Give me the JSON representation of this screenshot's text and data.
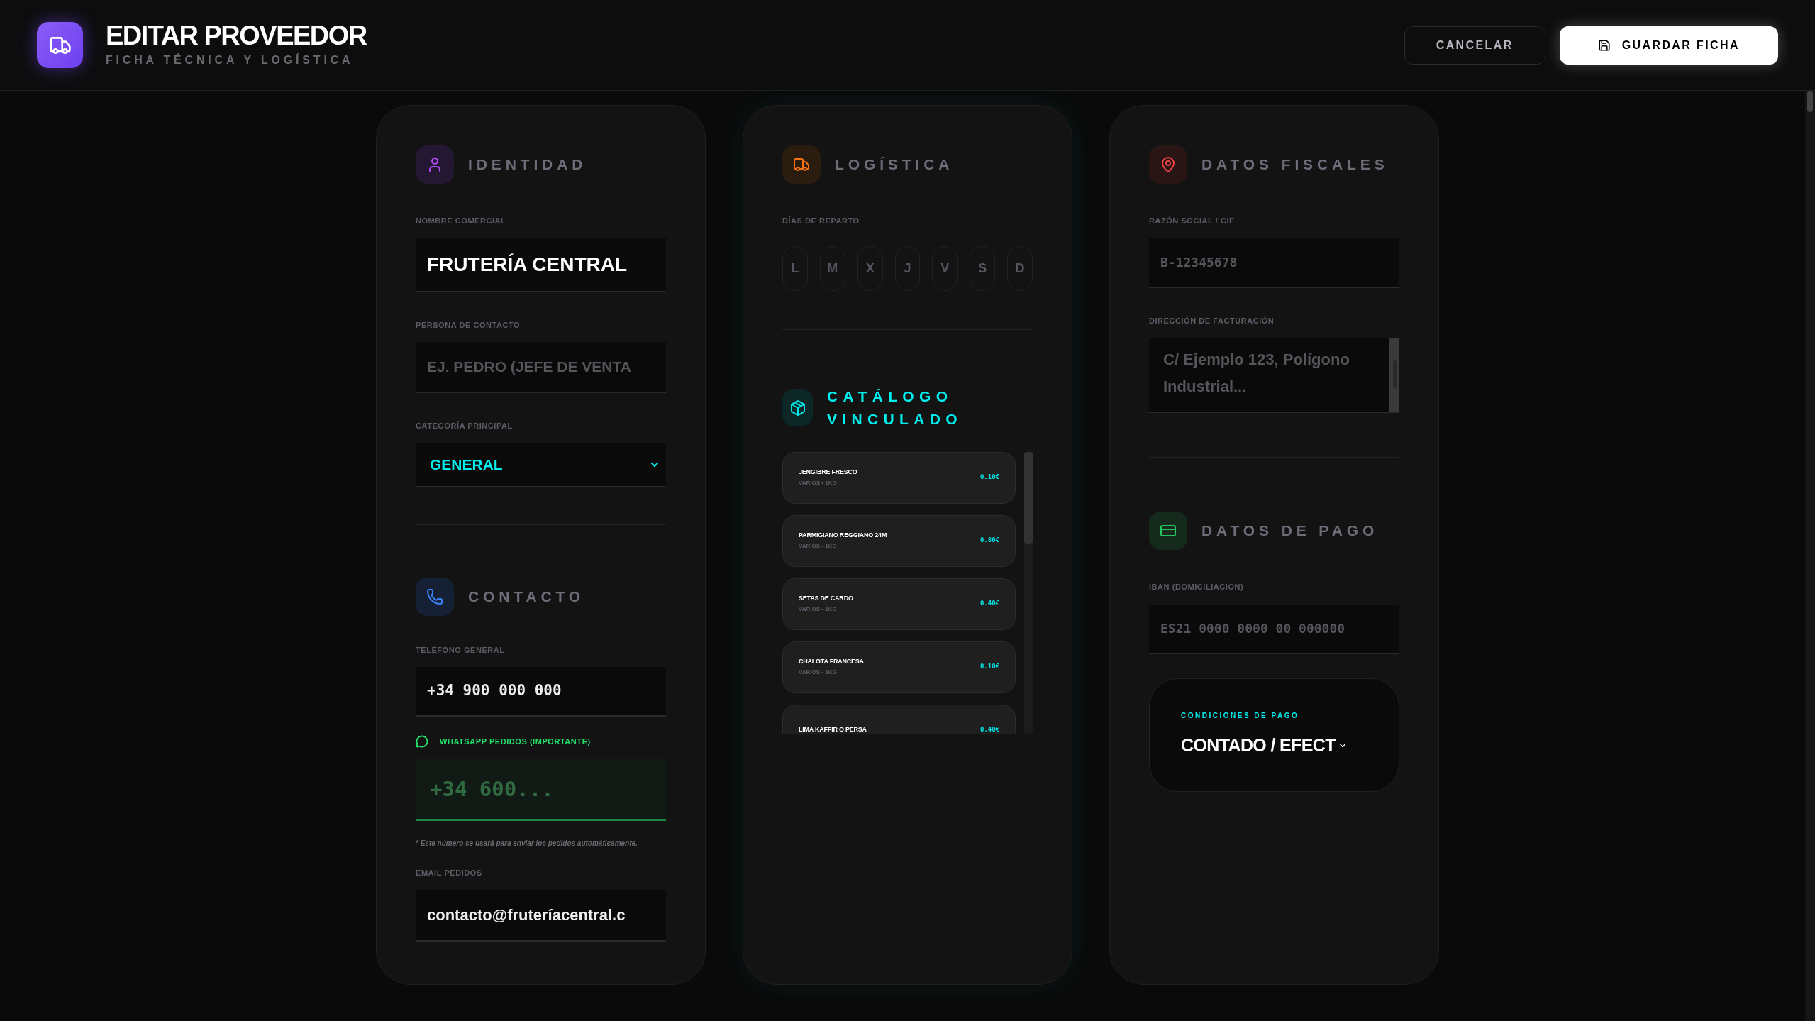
{
  "header": {
    "title": "EDITAR PROVEEDOR",
    "subtitle": "FICHA TÉCNICA Y LOGÍSTICA",
    "buttons": [
      {
        "label": "CANCELAR",
        "kind": "secondary"
      },
      {
        "label": "GUARDAR FICHA",
        "kind": "primary"
      }
    ]
  },
  "identidad": {
    "title": "IDENTIDAD",
    "fields": [
      {
        "kind": "name",
        "label": "NOMBRE COMERCIAL",
        "value": "FRUTERÍA CENTRAL"
      },
      {
        "kind": "text",
        "label": "PERSONA DE CONTACTO",
        "placeholder": "EJ. PEDRO (JEFE DE VENTA"
      },
      {
        "kind": "select",
        "label": "CATEGORÍA PRINCIPAL",
        "value": "GENERAL"
      }
    ]
  },
  "contacto": {
    "title": "CONTACTO",
    "fields": [
      {
        "kind": "mono",
        "label": "TELÉFONO GENERAL",
        "value": "+34 900 000 000"
      },
      {
        "kind": "whatsapp",
        "label": "WHATSAPP PEDIDOS (IMPORTANTE)",
        "placeholder": "+34 600...",
        "note": "* Este número se usará para enviar los pedidos automáticamente."
      },
      {
        "kind": "text",
        "label": "EMAIL PEDIDOS",
        "value": "contacto@fruteríacentral.c"
      }
    ]
  },
  "logistica": {
    "title": "LOGÍSTICA",
    "days_label": "DÍAS DE REPARTO",
    "days": [
      {
        "label": "L",
        "selected": false
      },
      {
        "label": "M",
        "selected": false
      },
      {
        "label": "X",
        "selected": false
      },
      {
        "label": "J",
        "selected": false
      },
      {
        "label": "V",
        "selected": false
      },
      {
        "label": "S",
        "selected": false
      },
      {
        "label": "D",
        "selected": false
      }
    ]
  },
  "catalogo": {
    "title": "CATÁLOGO VINCULADO",
    "items": [
      {
        "name": "JENGIBRE FRESCO",
        "detail": "VARIOS • 1KG",
        "price": "0.10€"
      },
      {
        "name": "PARMIGIANO REGGIANO 24M",
        "detail": "VARIOS • 1KG",
        "price": "0.80€"
      },
      {
        "name": "SETAS DE CARDO",
        "detail": "VARIOS • 1KG",
        "price": "0.40€"
      },
      {
        "name": "CHALOTA FRANCESA",
        "detail": "VARIOS • 1KG",
        "price": "0.10€"
      },
      {
        "name": "LIMA KAFFIR O PERSA",
        "price": "0.40€"
      }
    ]
  },
  "fiscales": {
    "title": "DATOS FISCALES",
    "fields": [
      {
        "kind": "mono",
        "label": "RAZÓN SOCIAL / CIF",
        "placeholder": "B-12345678"
      },
      {
        "kind": "textarea",
        "label": "DIRECCIÓN DE FACTURACIÓN",
        "placeholder": "C/ Ejemplo 123, Polígono Industrial..."
      }
    ]
  },
  "pago": {
    "title": "DATOS DE PAGO",
    "fields": [
      {
        "kind": "mono",
        "label": "IBAN (DOMICILIACIÓN)",
        "placeholder": "ES21 0000 0000 00 000000"
      }
    ],
    "conditions": {
      "label": "CONDICIONES DE PAGO",
      "value": "CONTADO / EFECT"
    }
  }
}
